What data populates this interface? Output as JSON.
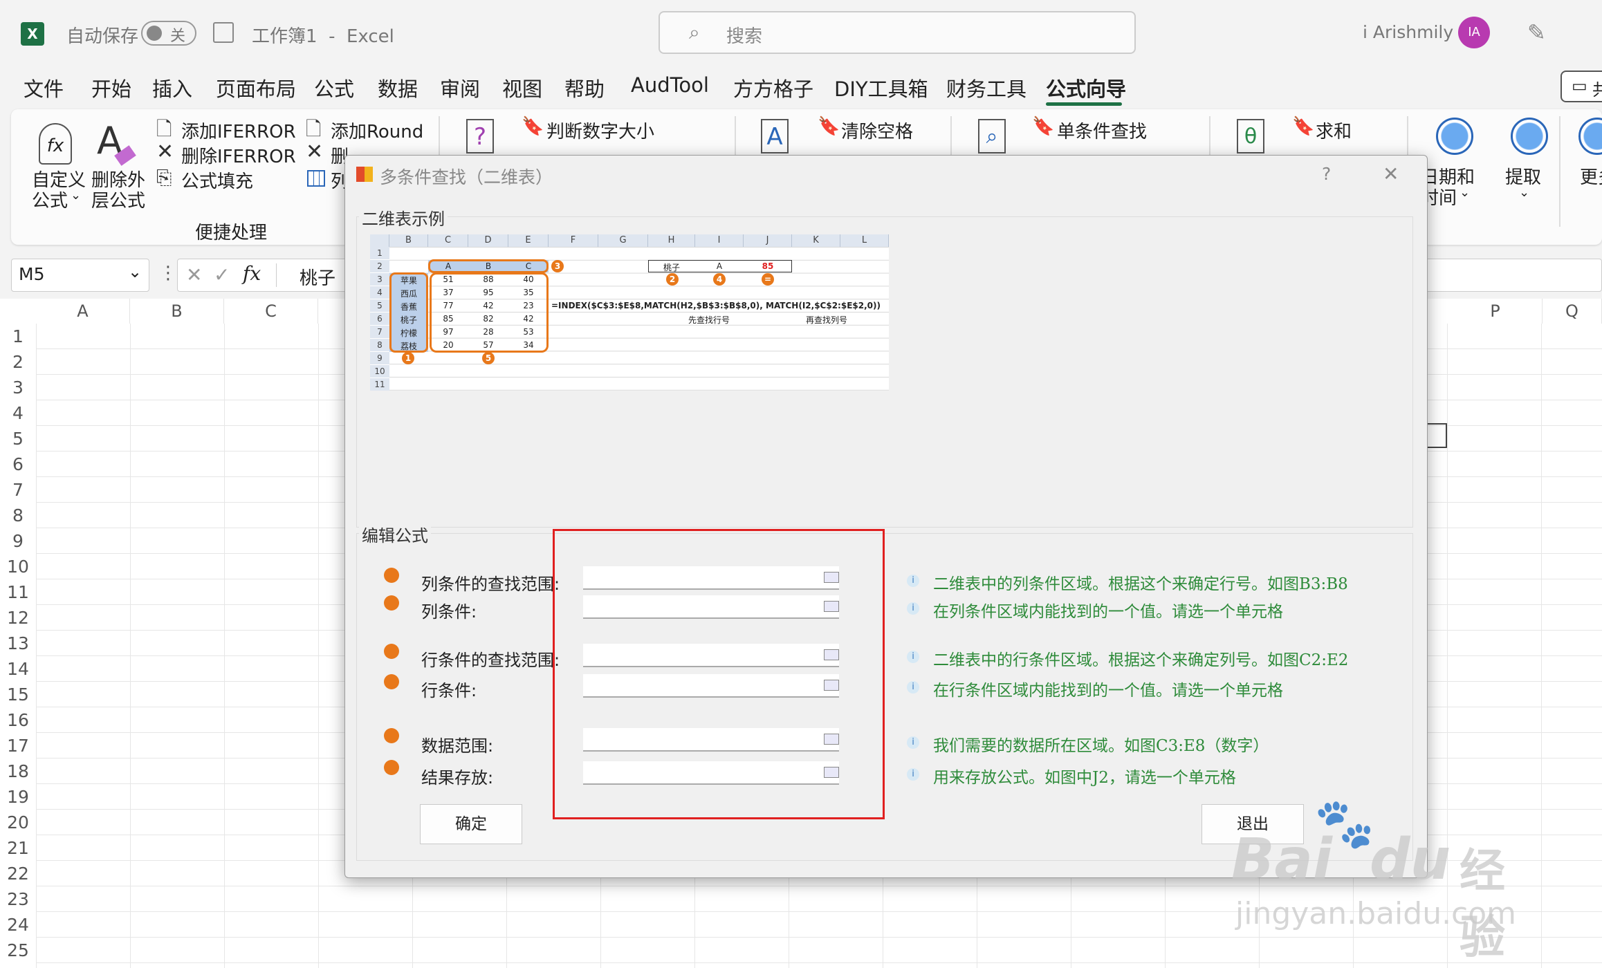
{
  "titlebar": {
    "autosave_label": "自动保存",
    "autosave_state": "关",
    "doc_title": "工作簿1  -  Excel",
    "search_placeholder": "搜索",
    "user_name": "i Arishmily",
    "avatar_initials": "IA"
  },
  "tabs": [
    "文件",
    "开始",
    "插入",
    "页面布局",
    "公式",
    "数据",
    "审阅",
    "视图",
    "帮助",
    "AudTool",
    "方方格子",
    "DIY工具箱",
    "财务工具",
    "公式向导"
  ],
  "tabs_active": "公式向导",
  "ribbon": {
    "custom_formula_1": "自定义",
    "custom_formula_2": "公式",
    "remove_outer_1": "删除外",
    "remove_outer_2": "层公式",
    "add_iferror": "添加IFERROR",
    "remove_iferror": "删除IFERROR",
    "formula_fill": "公式填充",
    "add_round": "添加Round",
    "remove_partial": "删",
    "column_partial": "列",
    "group_label": "便捷处理",
    "judge_number": "判断数字大小",
    "clear_space": "清除空格",
    "single_lookup": "单条件查找",
    "sum": "求和",
    "date_time_1": "日期和",
    "date_time_2": "时间",
    "extract": "提取",
    "more_partial": "更多",
    "share_partial": "共"
  },
  "formula_bar": {
    "name_box": "M5",
    "content": "桃子"
  },
  "grid": {
    "columns": [
      "A",
      "B",
      "C",
      "P",
      "Q"
    ],
    "rows": [
      "1",
      "2",
      "3",
      "4",
      "5",
      "6",
      "7",
      "8",
      "9",
      "10",
      "11",
      "12",
      "13",
      "14",
      "15",
      "16",
      "17",
      "18",
      "19",
      "20",
      "21",
      "22",
      "23",
      "24",
      "25"
    ]
  },
  "dialog": {
    "title": "多条件查找（二维表）",
    "help": "?",
    "close": "✕",
    "example_group": "二维表示例",
    "edit_group": "编辑公式",
    "fields": [
      {
        "label": "列条件的查找范围:",
        "hint": "二维表中的列条件区域。根据这个来确定行号。如图B3:B8"
      },
      {
        "label": "列条件:",
        "hint": "在列条件区域内能找到的一个值。请选一个单元格"
      },
      {
        "label": "行条件的查找范围:",
        "hint": "二维表中的行条件区域。根据这个来确定列号。如图C2:E2"
      },
      {
        "label": "行条件:",
        "hint": "在行条件区域内能找到的一个值。请选一个单元格"
      },
      {
        "label": "数据范围:",
        "hint": "我们需要的数据所在区域。如图C3:E8（数字）"
      },
      {
        "label": "结果存放:",
        "hint": "用来存放公式。如图中J2，请选一个单元格"
      }
    ],
    "ok_button": "确定",
    "exit_button": "退出"
  },
  "sample": {
    "col_headers": [
      "B",
      "C",
      "D",
      "E",
      "F",
      "G",
      "H",
      "I",
      "J",
      "K",
      "L"
    ],
    "row_headers": [
      "1",
      "2",
      "3",
      "4",
      "5",
      "6",
      "7",
      "8",
      "9",
      "10",
      "11"
    ],
    "fruits": [
      "苹果",
      "西瓜",
      "香蕉",
      "桃子",
      "柠檬",
      "荔枝"
    ],
    "headers": [
      "A",
      "B",
      "C"
    ],
    "values": [
      [
        "51",
        "88",
        "40"
      ],
      [
        "37",
        "95",
        "35"
      ],
      [
        "77",
        "42",
        "23"
      ],
      [
        "85",
        "82",
        "42"
      ],
      [
        "97",
        "28",
        "53"
      ],
      [
        "20",
        "57",
        "34"
      ]
    ],
    "lookup_fruit": "桃子",
    "lookup_header": "A",
    "lookup_result": "85",
    "formula": "=INDEX($C$3:$E$8,MATCH(H2,$B$3:$B$8,0), MATCH(I2,$C$2:$E$2,0))",
    "note_row": "先查找行号",
    "note_col": "再查找列号",
    "circle_labels": [
      "1",
      "2",
      "3",
      "4",
      "5",
      "="
    ]
  },
  "watermark": {
    "brand": "Bai",
    "brand2": "du",
    "cn": "经验",
    "url": "jingyan.baidu.com"
  },
  "colors": {
    "excel_green": "#1e7145",
    "avatar": "#b83ab0",
    "accent_orange": "#e8781a",
    "hint_green": "#2e8b3a",
    "highlight_red": "#e02020"
  }
}
